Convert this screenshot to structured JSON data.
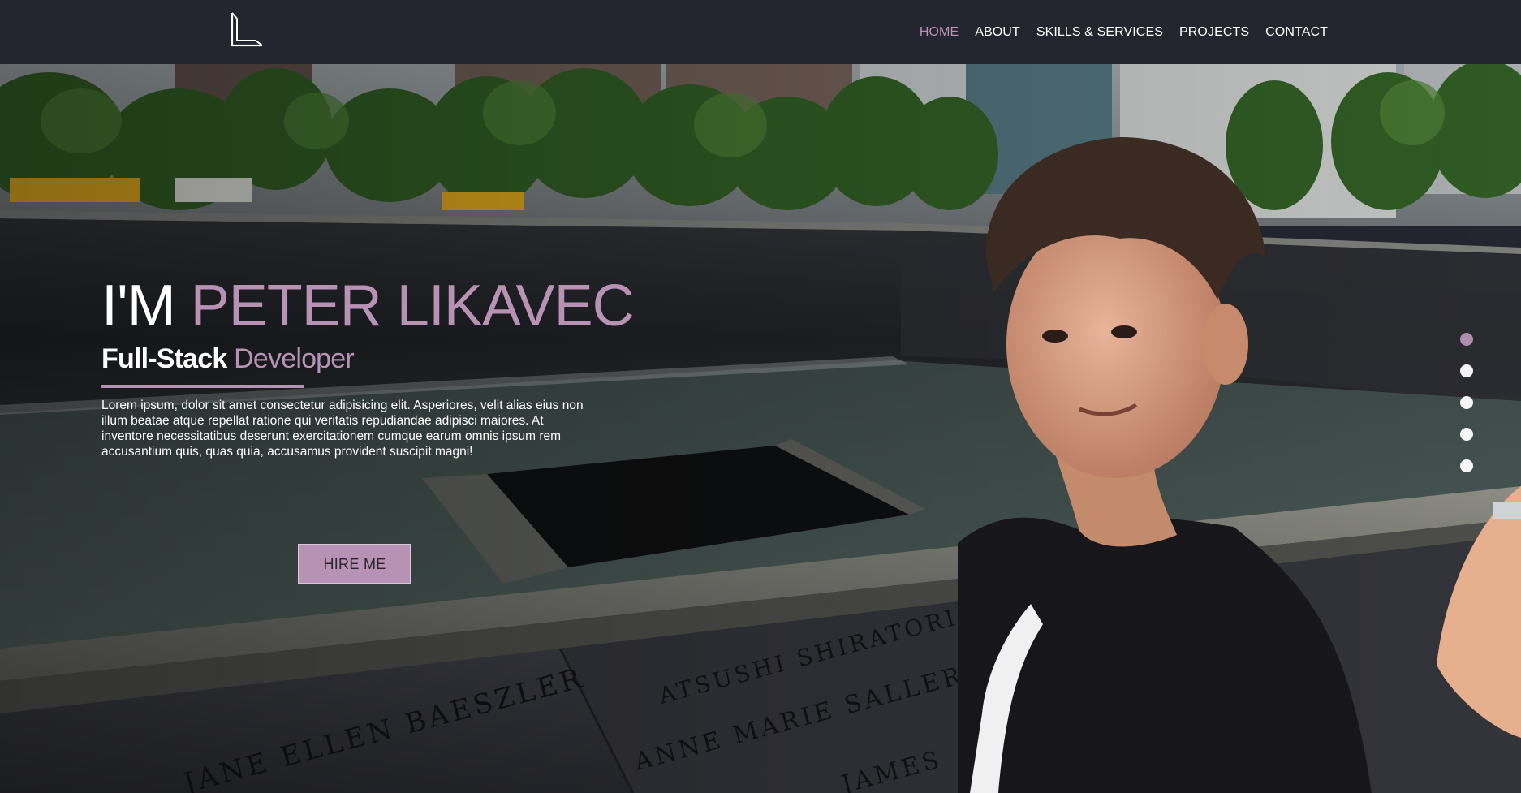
{
  "brand": {
    "logo_icon": "L-monogram-logo-icon"
  },
  "nav": {
    "items": [
      {
        "label": "HOME",
        "active": true
      },
      {
        "label": "ABOUT",
        "active": false
      },
      {
        "label": "SKILLS & SERVICES",
        "active": false
      },
      {
        "label": "PROJECTS",
        "active": false
      },
      {
        "label": "CONTACT",
        "active": false
      }
    ]
  },
  "hero": {
    "headline_prefix": "I'M",
    "headline_name": "PETER LIKAVEC",
    "subhead_primary": "Full-Stack",
    "subhead_accent": "Developer",
    "intro": "Lorem ipsum, dolor sit amet consectetur adipisicing elit. Asperiores, velit alias eius non illum beatae atque repellat ratione qui veritatis repudiandae adipisci maiores. At inventore necessitatibus deserunt exercitationem cumque earum omnis ipsum rem accusantium quis, quas quia, accusamus provident suscipit magni!",
    "cta_label": "HIRE ME",
    "background_image": "photo-at-memorial-fountain",
    "memorial_names": [
      "JANE ELLEN BAESZLER",
      "ATSUSHI SHIRATORI",
      "ANNE MARIE SALLERIN",
      "JAMES"
    ]
  },
  "slider": {
    "dot_count": 5,
    "active_index": 0
  },
  "colors": {
    "accent": "#b892b4",
    "navbar_bg": "#23252f",
    "text": "#ffffff"
  }
}
